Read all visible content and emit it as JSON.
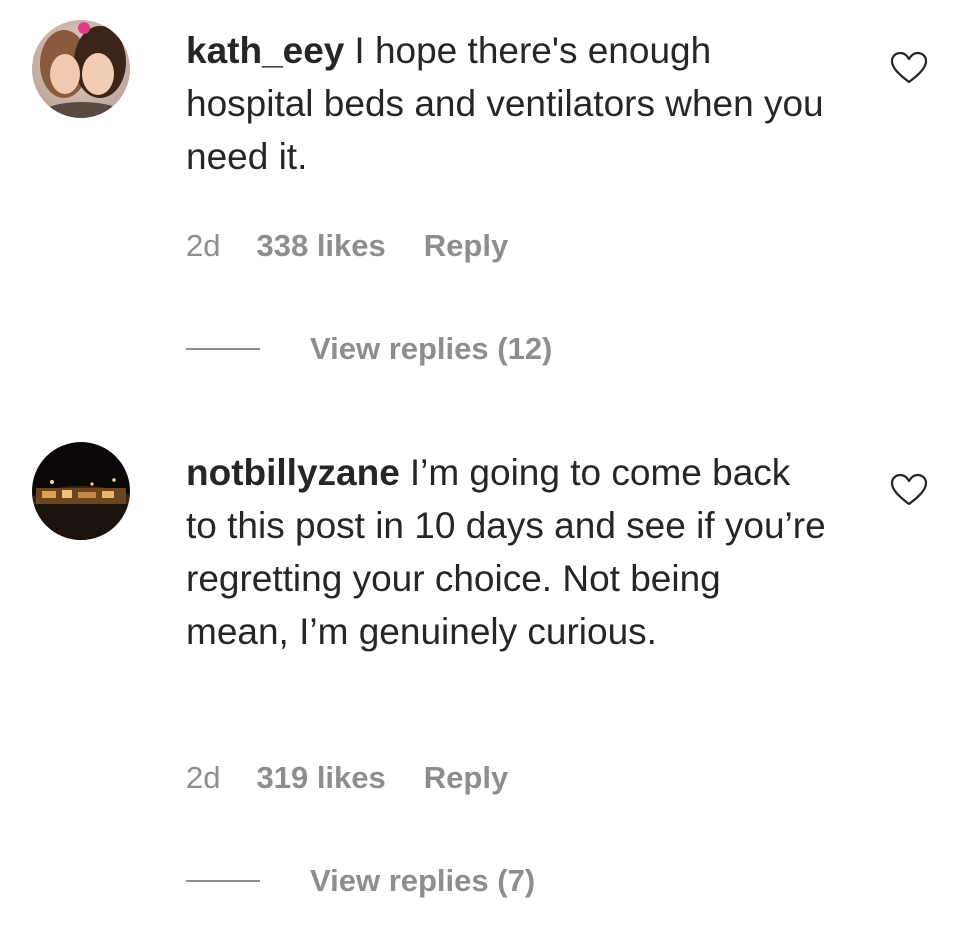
{
  "comments": [
    {
      "username": "kath_eey",
      "text": "I hope there's enough hospital beds and ventilators when you need it.",
      "time": "2d",
      "likes": "338 likes",
      "reply_label": "Reply",
      "view_replies": "View replies (12)",
      "avatar_icon": "profile-photo-two-women",
      "like_icon": "heart-outline-icon"
    },
    {
      "username": "notbillyzane",
      "text": "I’m going to come back to this post in 10 days and see if you’re regretting your choice. Not being mean, I’m genuinely curious.",
      "time": "2d",
      "likes": "319 likes",
      "reply_label": "Reply",
      "view_replies": "View replies (7)",
      "avatar_icon": "profile-photo-night-scene",
      "like_icon": "heart-outline-icon"
    }
  ],
  "colors": {
    "text": "#262626",
    "secondary": "#8e8e8e",
    "background": "#ffffff"
  }
}
